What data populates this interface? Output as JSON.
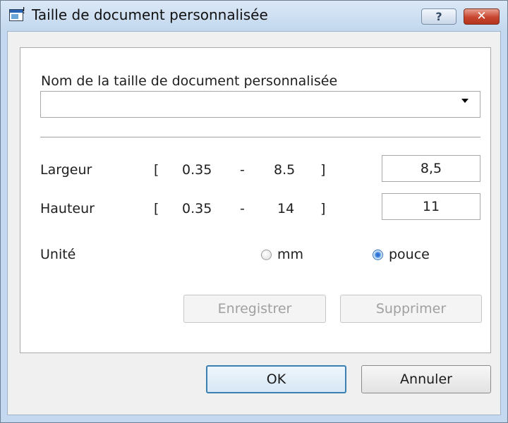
{
  "window": {
    "title": "Taille de document personnalisée",
    "help_label": "?",
    "close_label": "✕"
  },
  "name_field": {
    "label": "Nom de la taille de document personnalisée",
    "value": ""
  },
  "width": {
    "label": "Largeur",
    "bracket_open": "[",
    "min": "0.35",
    "dash": "-",
    "max": "8.5",
    "bracket_close": "]",
    "value": "8,5"
  },
  "height": {
    "label": "Hauteur",
    "bracket_open": "[",
    "min": "0.35",
    "dash": "-",
    "max": "14",
    "bracket_close": "]",
    "value": "11"
  },
  "unit": {
    "label": "Unité",
    "options": [
      {
        "label": "mm",
        "selected": false
      },
      {
        "label": "pouce",
        "selected": true
      }
    ]
  },
  "buttons": {
    "save": "Enregistrer",
    "delete": "Supprimer",
    "ok": "OK",
    "cancel": "Annuler"
  },
  "icons": {
    "app": "document-window-icon",
    "help": "help-icon",
    "close": "close-icon",
    "dropdown": "chevron-down-icon"
  },
  "colors": {
    "close_button": "#c8452e",
    "radio_selected": "#2b62c6",
    "default_button_border": "#3c7fb1"
  }
}
